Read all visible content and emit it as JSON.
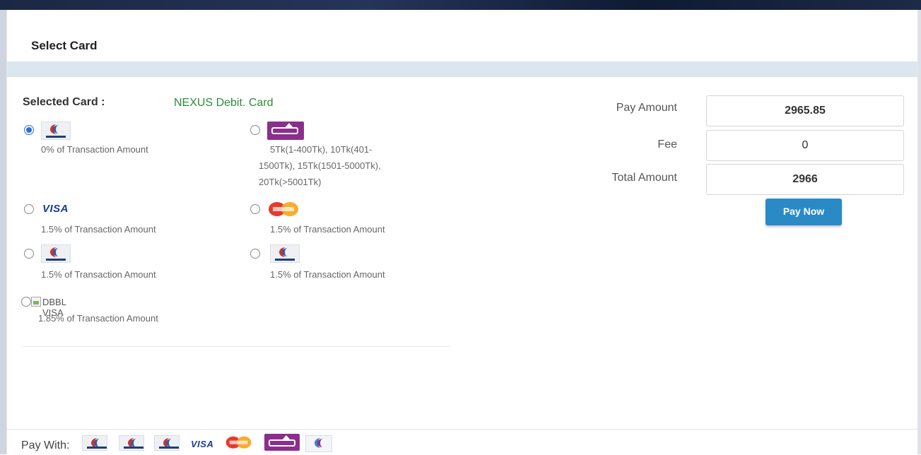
{
  "panel": {
    "title": "Select Card"
  },
  "selected": {
    "label": "Selected Card :",
    "value": "NEXUS Debit. Card"
  },
  "options": [
    {
      "id": "nexus",
      "logo": "dbbl-nexus-logo",
      "desc": "0% of Transaction Amount",
      "checked": true
    },
    {
      "id": "bkash",
      "logo": "bkash-logo",
      "desc_lines": [
        "5Tk(1-400Tk), 10Tk(401-",
        "1500Tk), 15Tk(1501-5000Tk),",
        "20Tk(>5001Tk)"
      ],
      "checked": false
    },
    {
      "id": "visa",
      "logo": "visa-logo",
      "logo_text": "VISA",
      "desc": "1.5% of Transaction Amount",
      "checked": false
    },
    {
      "id": "mastercard",
      "logo": "mastercard-logo",
      "desc": "1.5% of Transaction Amount",
      "checked": false
    },
    {
      "id": "dbbl-1",
      "logo": "dbbl-logo",
      "desc": "1.5% of Transaction Amount",
      "checked": false
    },
    {
      "id": "dbbl-2",
      "logo": "dbbl-logo",
      "desc": "1.5% of Transaction Amount",
      "checked": false
    },
    {
      "id": "dbbl-visa",
      "logo": "broken-image-icon",
      "alt": "DBBL VISA",
      "desc": "1.85% of Transaction Amount",
      "checked": false
    }
  ],
  "summary": {
    "pay_amount_label": "Pay Amount",
    "pay_amount": "2965.85",
    "fee_label": "Fee",
    "fee": "0",
    "total_label": "Total Amount",
    "total": "2966",
    "pay_button": "Pay Now"
  },
  "footer": {
    "label": "Pay With:",
    "logos": [
      "dbbl-nexus-logo",
      "dbbl-nexus-logo",
      "dbbl-nexus-logo",
      "visa-logo",
      "mastercard-logo",
      "bkash-logo",
      "rocket-logo"
    ],
    "visa_text": "VISA"
  },
  "colors": {
    "accent": "#2a8ac6",
    "selected_text": "#2e8b3a",
    "band": "#dce6ef"
  }
}
